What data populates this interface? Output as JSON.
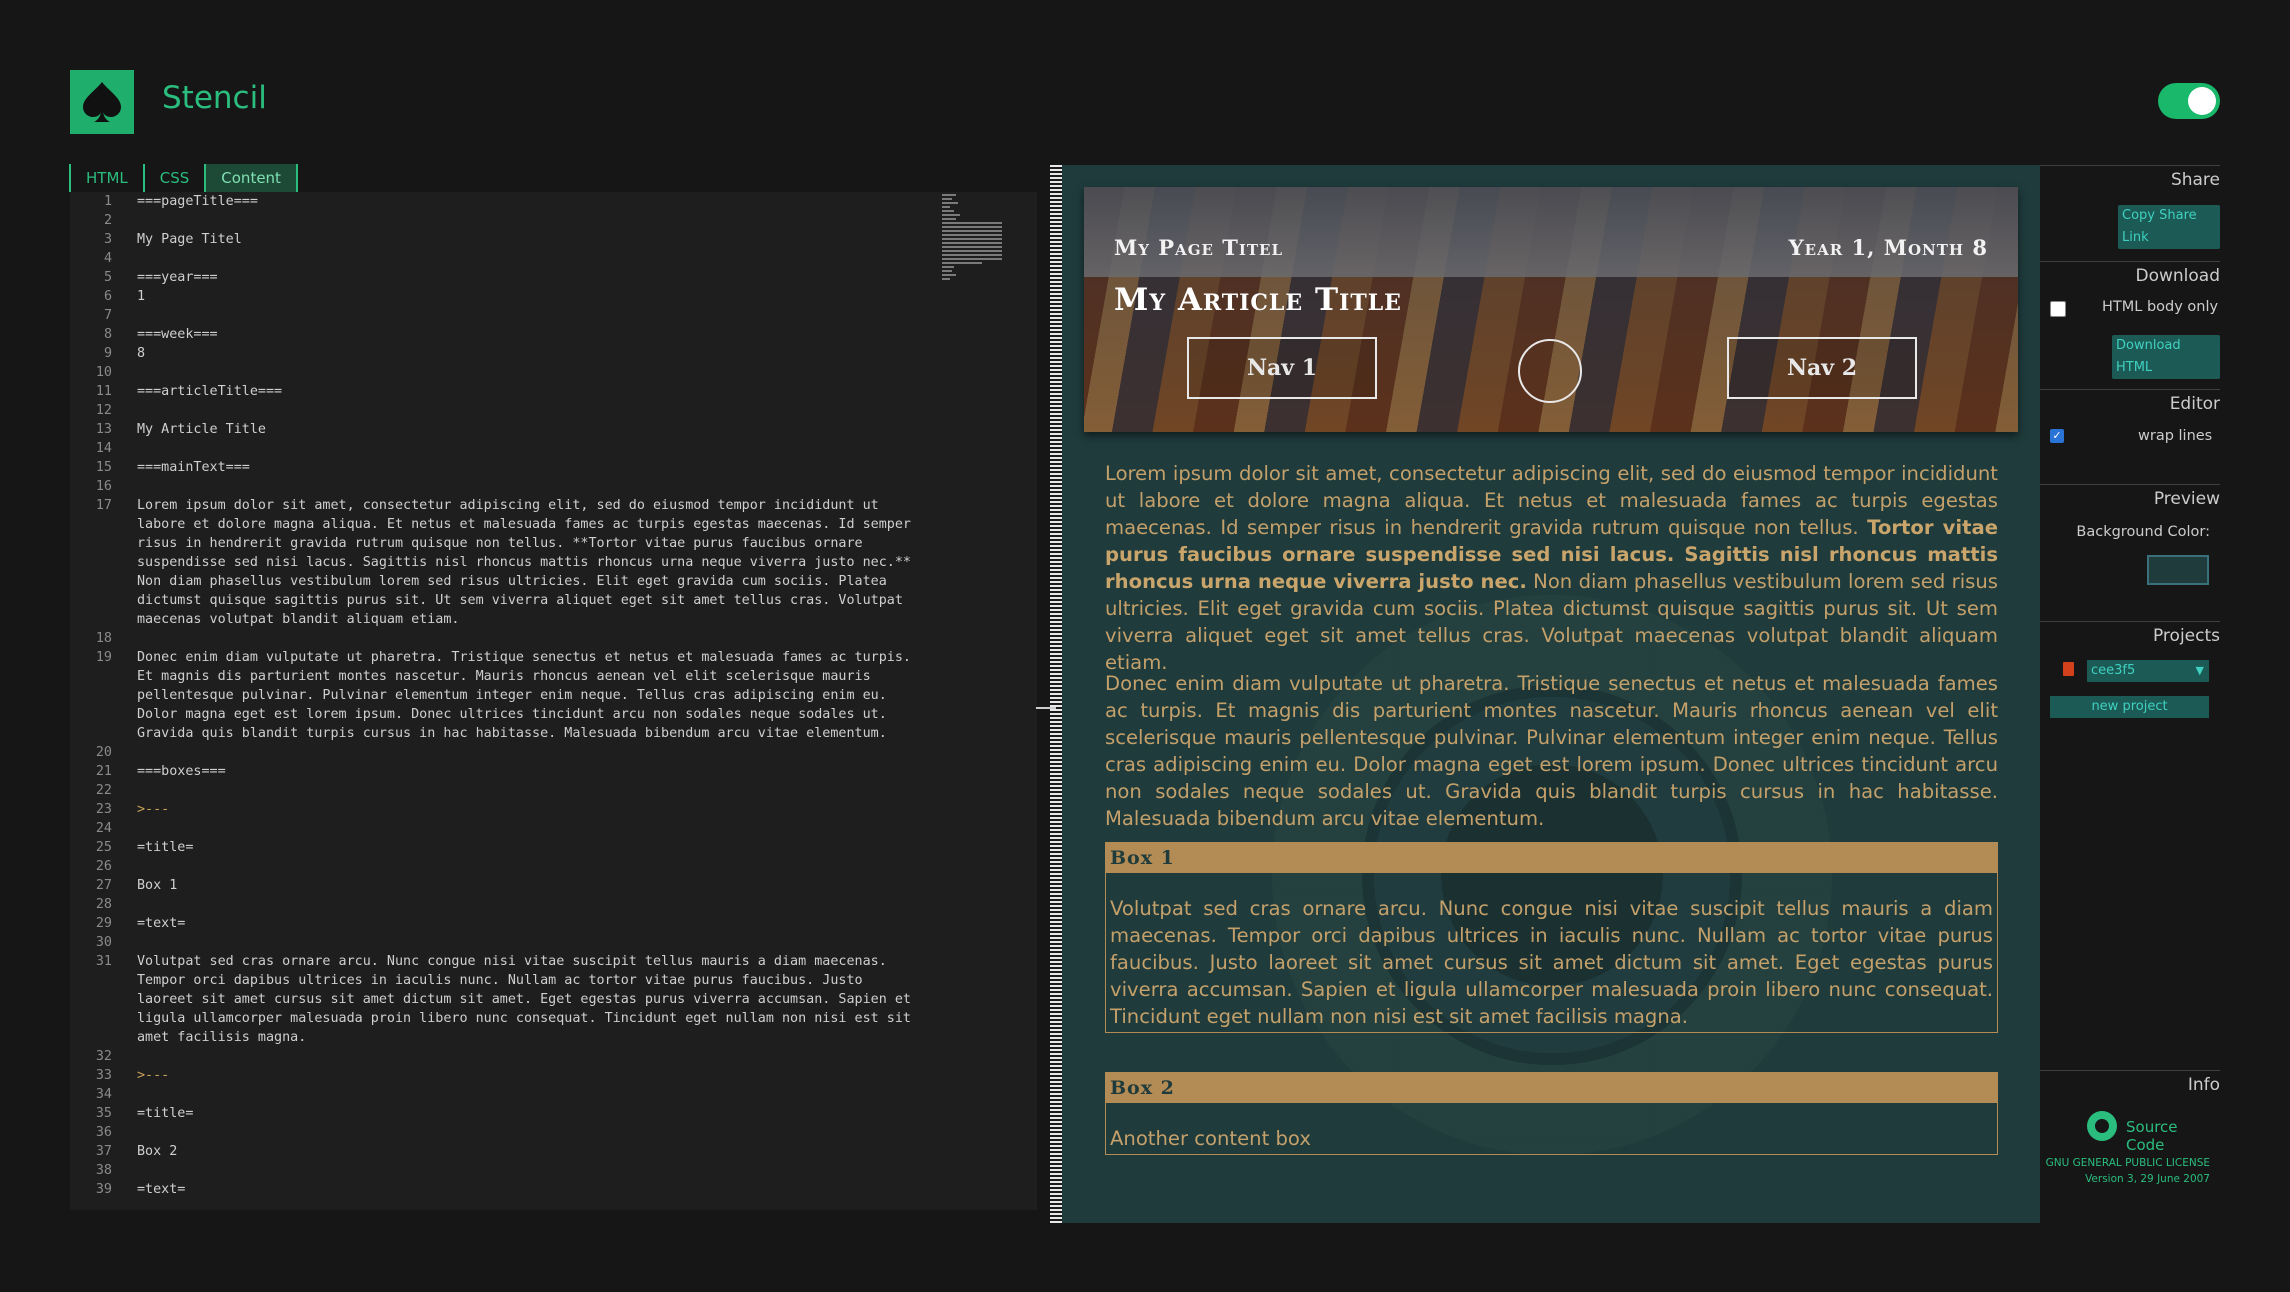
{
  "app": {
    "name": "Stencil",
    "logo_icon": "spade-icon",
    "accent": "#2bbd7e"
  },
  "tabs": [
    {
      "label": "HTML"
    },
    {
      "label": "CSS"
    },
    {
      "label": "Content",
      "active": true
    }
  ],
  "editor": {
    "lines": [
      {
        "n": "1",
        "t": "===pageTitle==="
      },
      {
        "n": "2",
        "t": ""
      },
      {
        "n": "3",
        "t": "My Page Titel"
      },
      {
        "n": "4",
        "t": ""
      },
      {
        "n": "5",
        "t": "===year==="
      },
      {
        "n": "6",
        "t": "1"
      },
      {
        "n": "7",
        "t": ""
      },
      {
        "n": "8",
        "t": "===week==="
      },
      {
        "n": "9",
        "t": "8"
      },
      {
        "n": "10",
        "t": ""
      },
      {
        "n": "11",
        "t": "===articleTitle==="
      },
      {
        "n": "12",
        "t": ""
      },
      {
        "n": "13",
        "t": "My Article Title"
      },
      {
        "n": "14",
        "t": ""
      },
      {
        "n": "15",
        "t": "===mainText==="
      },
      {
        "n": "16",
        "t": ""
      },
      {
        "n": "17",
        "t": "Lorem ipsum dolor sit amet, consectetur adipiscing elit, sed do eiusmod tempor incididunt ut labore et dolore magna aliqua. Et netus et malesuada fames ac turpis egestas maecenas. Id semper risus in hendrerit gravida rutrum quisque non tellus. **Tortor vitae purus faucibus ornare suspendisse sed nisi lacus. Sagittis nisl rhoncus mattis rhoncus urna neque viverra justo nec.** Non diam phasellus vestibulum lorem sed risus ultricies. Elit eget gravida cum sociis. Platea dictumst quisque sagittis purus sit. Ut sem viverra aliquet eget sit amet tellus cras. Volutpat maecenas volutpat blandit aliquam etiam."
      },
      {
        "n": "18",
        "t": ""
      },
      {
        "n": "19",
        "t": "Donec enim diam vulputate ut pharetra. Tristique senectus et netus et malesuada fames ac turpis. Et magnis dis parturient montes nascetur. Mauris rhoncus aenean vel elit scelerisque mauris pellentesque pulvinar. Pulvinar elementum integer enim neque. Tellus cras adipiscing enim eu. Dolor magna eget est lorem ipsum. Donec ultrices tincidunt arcu non sodales neque sodales ut. Gravida quis blandit turpis cursus in hac habitasse. Malesuada bibendum arcu vitae elementum."
      },
      {
        "n": "20",
        "t": ""
      },
      {
        "n": "21",
        "t": "===boxes==="
      },
      {
        "n": "22",
        "t": ""
      },
      {
        "n": "23",
        "t": ">---"
      },
      {
        "n": "24",
        "t": ""
      },
      {
        "n": "25",
        "t": "=title="
      },
      {
        "n": "26",
        "t": ""
      },
      {
        "n": "27",
        "t": "Box 1"
      },
      {
        "n": "28",
        "t": ""
      },
      {
        "n": "29",
        "t": "=text="
      },
      {
        "n": "30",
        "t": ""
      },
      {
        "n": "31",
        "t": "Volutpat sed cras ornare arcu. Nunc congue nisi vitae suscipit tellus mauris a diam maecenas. Tempor orci dapibus ultrices in iaculis nunc. Nullam ac tortor vitae purus faucibus. Justo laoreet sit amet cursus sit amet dictum sit amet. Eget egestas purus viverra accumsan. Sapien et ligula ullamcorper malesuada proin libero nunc consequat. Tincidunt eget nullam non nisi est sit amet facilisis magna."
      },
      {
        "n": "32",
        "t": ""
      },
      {
        "n": "33",
        "t": ">---"
      },
      {
        "n": "34",
        "t": ""
      },
      {
        "n": "35",
        "t": "=title="
      },
      {
        "n": "36",
        "t": ""
      },
      {
        "n": "37",
        "t": "Box 2"
      },
      {
        "n": "38",
        "t": ""
      },
      {
        "n": "39",
        "t": "=text="
      }
    ]
  },
  "preview": {
    "page_title": "My Page Titel",
    "year_week": "Year 1, Month 8",
    "article_title": "My Article Title",
    "nav1": "Nav 1",
    "nav2": "Nav 2",
    "para1_a": "Lorem ipsum dolor sit amet, consectetur adipiscing elit, sed do eiusmod tempor incididunt ut labore et dolore magna aliqua. Et netus et malesuada fames ac turpis egestas maecenas. Id semper risus in hendrerit gravida rutrum quisque non tellus. ",
    "para1_bold": "Tortor vitae purus faucibus ornare suspendisse sed nisi lacus. Sagittis nisl rhoncus mattis rhoncus urna neque viverra justo nec.",
    "para1_b": " Non diam phasellus vestibulum lorem sed risus ultricies. Elit eget gravida cum sociis. Platea dictumst quisque sagittis purus sit. Ut sem viverra aliquet eget sit amet tellus cras. Volutpat maecenas volutpat blandit aliquam etiam.",
    "para2": "Donec enim diam vulputate ut pharetra. Tristique senectus et netus et malesuada fames ac turpis. Et magnis dis parturient montes nascetur. Mauris rhoncus aenean vel elit scelerisque mauris pellentesque pulvinar. Pulvinar elementum integer enim neque. Tellus cras adipiscing enim eu. Dolor magna eget est lorem ipsum. Donec ultrices tincidunt arcu non sodales neque sodales ut. Gravida quis blandit turpis cursus in hac habitasse. Malesuada bibendum arcu vitae elementum.",
    "box1_title": "Box 1",
    "box1_text": "Volutpat sed cras ornare arcu. Nunc congue nisi vitae suscipit tellus mauris a diam maecenas. Tempor orci dapibus ultrices in iaculis nunc. Nullam ac tortor vitae purus faucibus. Justo laoreet sit amet cursus sit amet dictum sit amet. Eget egestas purus viverra accumsan. Sapien et ligula ullamcorper malesuada proin libero nunc consequat. Tincidunt eget nullam non nisi est sit amet facilisis magna.",
    "box2_title": "Box 2",
    "box2_text": "Another content box",
    "text_color": "#c4a06a",
    "box_color": "#b38b55"
  },
  "sidebar": {
    "share": {
      "title": "Share",
      "copy_button": "Copy Share Link"
    },
    "download": {
      "title": "Download",
      "checkbox_label": "HTML body only",
      "checked": false,
      "button": "Download HTML"
    },
    "editor": {
      "title": "Editor",
      "checkbox_label": "wrap lines",
      "checked": true
    },
    "preview": {
      "title": "Preview",
      "bg_label": "Background Color:",
      "bg_color": "#1f3b3c"
    },
    "projects": {
      "title": "Projects",
      "selected": "cee3f5",
      "new_button": "new project"
    },
    "info": {
      "title": "Info",
      "source_link": "Source Code",
      "license1": "GNU GENERAL PUBLIC LICENSE",
      "license2": "Version 3, 29 June 2007"
    }
  }
}
